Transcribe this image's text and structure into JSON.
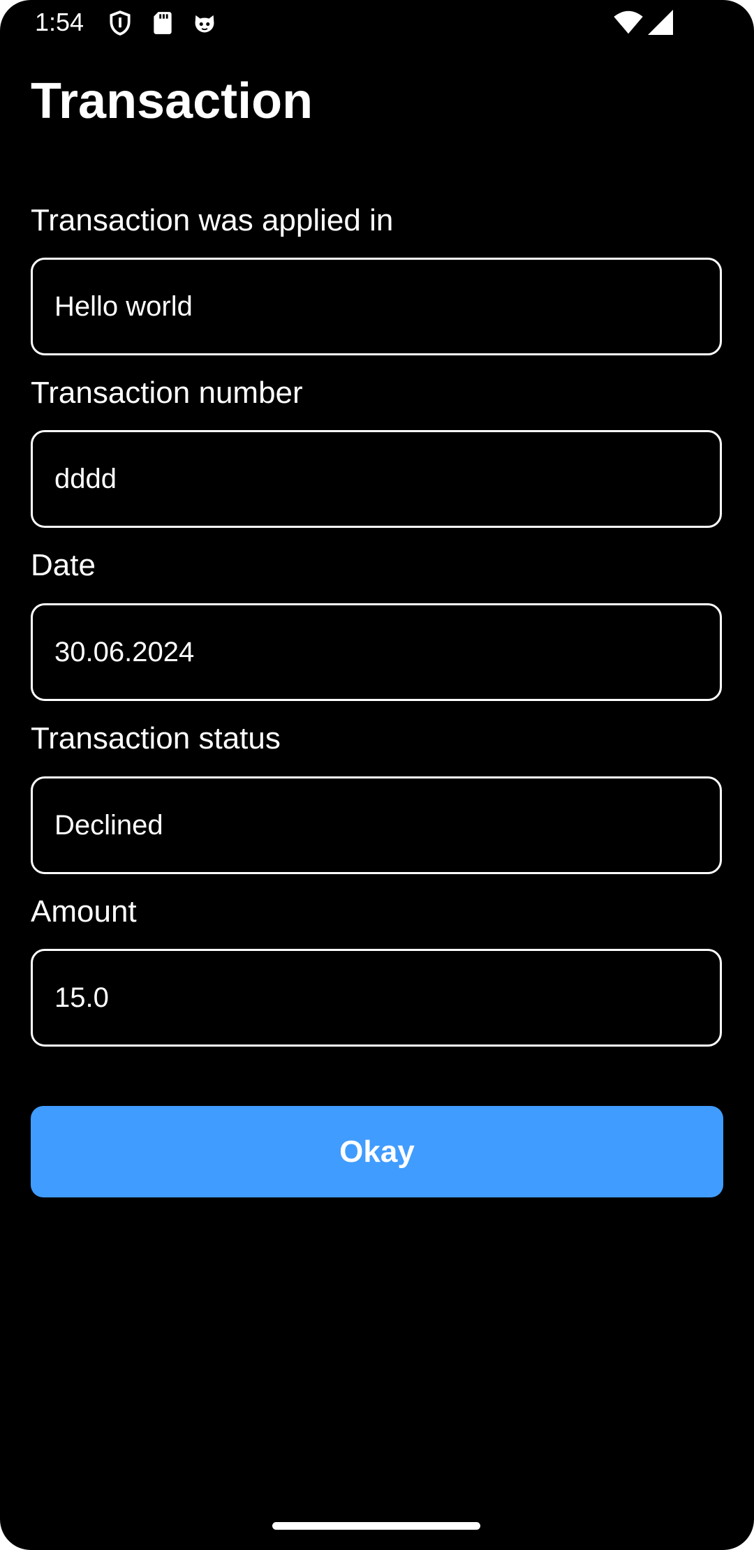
{
  "status_bar": {
    "time": "1:54",
    "left_icons": [
      "shield-icon",
      "sd-card-icon",
      "cat-icon"
    ],
    "right_icons": [
      "wifi-icon",
      "cell-signal-icon"
    ]
  },
  "header": {
    "title": "Transaction"
  },
  "form": {
    "applied_in": {
      "label": "Transaction was applied in",
      "value": "Hello world"
    },
    "number": {
      "label": "Transaction number",
      "value": "dddd"
    },
    "date": {
      "label": "Date",
      "value": "30.06.2024"
    },
    "status": {
      "label": "Transaction status",
      "value": "Declined"
    },
    "amount": {
      "label": "Amount",
      "value": "15.0"
    }
  },
  "actions": {
    "okay_label": "Okay"
  },
  "colors": {
    "background": "#000000",
    "text": "#ffffff",
    "accent": "#409cff"
  }
}
